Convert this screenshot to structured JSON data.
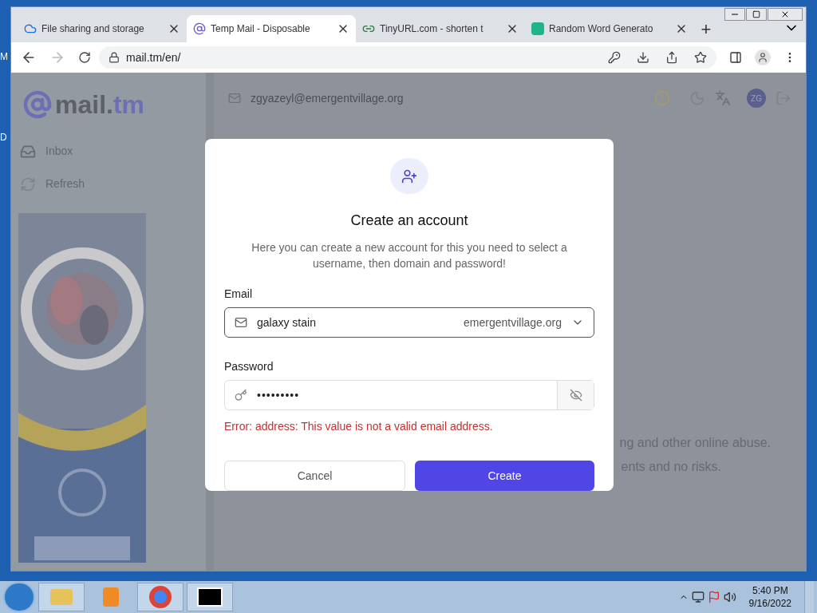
{
  "desktop_labels": [
    "M",
    "D"
  ],
  "tabs": [
    {
      "label": "File sharing and storage",
      "selected": false
    },
    {
      "label": "Temp Mail - Disposable",
      "selected": true
    },
    {
      "label": "TinyURL.com - shorten t",
      "selected": false
    },
    {
      "label": "Random Word Generato",
      "selected": false
    }
  ],
  "new_tab": "+",
  "address": "mail.tm/en/",
  "sidebar": {
    "logo": [
      "mail.",
      "tm"
    ],
    "items": [
      {
        "label": "Inbox",
        "kind": "inbox"
      },
      {
        "label": "Refresh",
        "kind": "refresh"
      }
    ]
  },
  "header": {
    "email": "zgyazeyl@emergentvillage.org",
    "avatar": "ZG"
  },
  "background_text": [
    "ng and other online abuse.",
    "ents and no risks."
  ],
  "dialog": {
    "title": "Create an account",
    "description": "Here you can create a new account for this you need to select a username, then domain and password!",
    "email_label": "Email",
    "email_value": "galaxy stain",
    "domain": "emergentvillage.org",
    "password_label": "Password",
    "password_value": "•••••••••",
    "error": "Error: address: This value is not a valid email address.",
    "cancel": "Cancel",
    "create": "Create"
  },
  "taskbar": {
    "time": "5:40 PM",
    "date": "9/16/2022"
  }
}
